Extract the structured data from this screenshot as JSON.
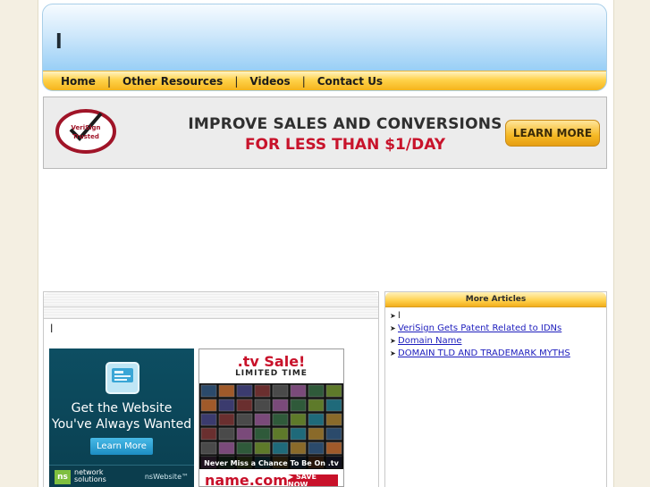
{
  "header": {
    "site_title": "l",
    "nav": [
      {
        "label": "Home"
      },
      {
        "label": "Other Resources"
      },
      {
        "label": "Videos"
      },
      {
        "label": "Contact Us"
      }
    ],
    "nav_separator": "|"
  },
  "promo_banner": {
    "seal_line1": "VeriSign",
    "seal_line2": "Trusted",
    "line1": "IMPROVE SALES AND CONVERSIONS",
    "line2": "FOR LESS THAN $1/DAY",
    "button_label": "LEARN MORE"
  },
  "main": {
    "text": "l"
  },
  "ad_network_solutions": {
    "headline_line1": "Get the Website",
    "headline_line2": "You've Always Wanted",
    "button_label": "Learn More",
    "logo_text": "ns",
    "brand_line1": "network",
    "brand_line2": "solutions",
    "product": "nsWebsite™"
  },
  "ad_tv": {
    "title": ".tv Sale!",
    "subtitle": "LIMITED TIME",
    "caption": "Never Miss a Chance To Be On .tv",
    "brand": "name.com",
    "button_label": "▶ SAVE NOW"
  },
  "sidebar": {
    "title": "More Articles",
    "items": [
      {
        "label": "l",
        "link": false
      },
      {
        "label": "VeriSign Gets Patent Related to IDNs",
        "link": true
      },
      {
        "label": "Domain Name",
        "link": true
      },
      {
        "label": "DOMAIN TLD AND TRADEMARK MYTHS",
        "link": true
      }
    ]
  },
  "colors": {
    "nav_gold": "#ffd24a",
    "header_blue": "#9bd0f6",
    "promo_red": "#c8132b",
    "link_blue": "#1d1dbd"
  }
}
